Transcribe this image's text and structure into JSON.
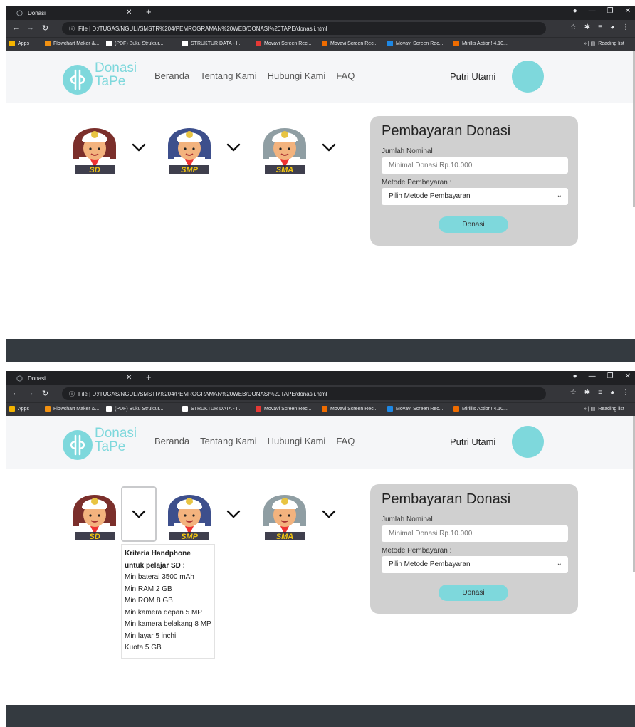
{
  "browser": {
    "tab_title": "Donasi",
    "url": "D:/TUGAS/NGULI/SMSTR%204/PEMROGRAMAN%20WEB/DONASI%20TAPE/donasii.html",
    "url_prefix": "File",
    "bookmarks": [
      {
        "label": "Apps",
        "color": "#f4b400"
      },
      {
        "label": "Flowchart Maker &...",
        "color": "#f29111"
      },
      {
        "label": "(PDF) Buku Struktur...",
        "color": "#ffffff"
      },
      {
        "label": "STRUKTUR DATA - I...",
        "color": "#ffffff"
      },
      {
        "label": "Movavi Screen Rec...",
        "color": "#e53935"
      },
      {
        "label": "Movavi Screen Rec...",
        "color": "#ef6c00"
      },
      {
        "label": "Movavi Screen Rec...",
        "color": "#1e88e5"
      },
      {
        "label": "Mirillis Action! 4.10...",
        "color": "#ef6c00"
      }
    ],
    "reading_list": "Reading list"
  },
  "site": {
    "brand_line1": "Donasi",
    "brand_line2": "TaPe",
    "menu": [
      "Beranda",
      "Tentang Kami",
      "Hubungi Kami",
      "FAQ"
    ],
    "user_name": "Putri Utami",
    "accent_color": "#7ed8dc"
  },
  "levels": [
    {
      "badge": "SD",
      "hat_color": "#7b2f2b",
      "shirt_color": "#ffffff"
    },
    {
      "badge": "SMP",
      "hat_color": "#3d4f8c",
      "shirt_color": "#ffffff"
    },
    {
      "badge": "SMA",
      "hat_color": "#8f9ea3",
      "shirt_color": "#ffffff"
    }
  ],
  "tooltip": {
    "heading": "Kriteria Handphone untuk pelajar SD :",
    "items": [
      "Min baterai 3500 mAh",
      "Min RAM 2 GB",
      "Min ROM 8 GB",
      "Min kamera depan 5 MP",
      "Min kamera belakang 8 MP",
      "Min layar 5 inchi",
      "Kuota 5 GB"
    ]
  },
  "payment": {
    "title": "Pembayaran Donasi",
    "amount_label": "Jumlah Nominal",
    "amount_placeholder": "Minimal Donasi Rp.10.000",
    "method_label": "Metode Pembayaran :",
    "method_value": "Pilih Metode Pembayaran",
    "button": "Donasi"
  }
}
